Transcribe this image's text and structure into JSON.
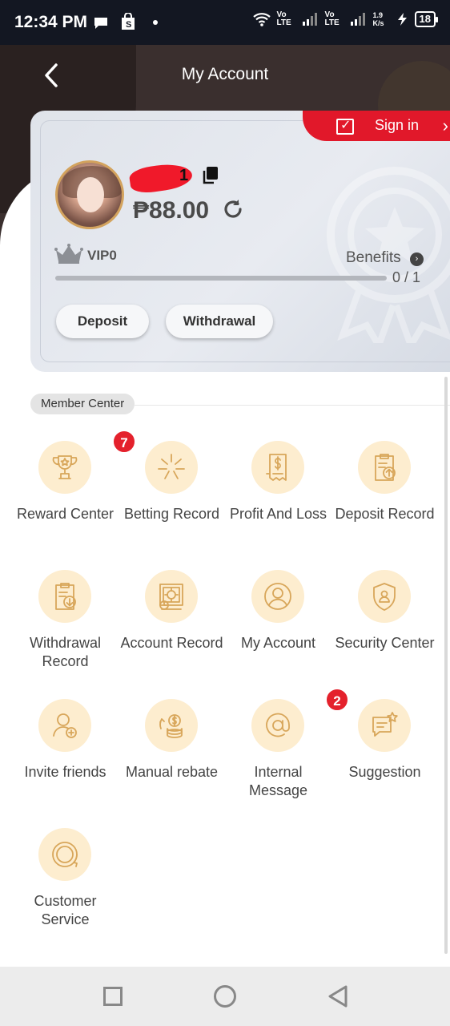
{
  "status_bar": {
    "time": "12:34 PM",
    "net1": "Vo LTE",
    "net2": "Vo LTE",
    "speed": "1.9 K/s",
    "battery": "18"
  },
  "header": {
    "title": "My Account",
    "back_icon": "chevron-left-icon"
  },
  "card": {
    "sign_in_label": "Sign in",
    "username_visible": "1",
    "balance": "₱88.00",
    "vip_label": "VIP0",
    "benefits_label": "Benefits",
    "progress_text": "0 / 1",
    "progress_value": 0,
    "deposit_label": "Deposit",
    "withdrawal_label": "Withdrawal"
  },
  "member_center": {
    "title": "Member Center",
    "items": [
      {
        "label": "Reward Center",
        "icon": "trophy-icon",
        "badge": "7"
      },
      {
        "label": "Betting Record",
        "icon": "star-burst-icon",
        "badge": ""
      },
      {
        "label": "Profit And Loss",
        "icon": "receipt-dollar-icon",
        "badge": ""
      },
      {
        "label": "Deposit Record",
        "icon": "clipboard-upload-icon",
        "badge": ""
      },
      {
        "label": "Withdrawal Record",
        "icon": "clipboard-download-icon",
        "badge": ""
      },
      {
        "label": "Account Record",
        "icon": "safe-clock-icon",
        "badge": ""
      },
      {
        "label": "My Account",
        "icon": "user-circle-icon",
        "badge": ""
      },
      {
        "label": "Security Center",
        "icon": "shield-user-icon",
        "badge": ""
      },
      {
        "label": "Invite friends",
        "icon": "user-add-icon",
        "badge": ""
      },
      {
        "label": "Manual rebate",
        "icon": "coins-rebate-icon",
        "badge": ""
      },
      {
        "label": "Internal Message",
        "icon": "at-sign-icon",
        "badge": "2"
      },
      {
        "label": "Suggestion",
        "icon": "chat-star-icon",
        "badge": ""
      },
      {
        "label": "Customer Service",
        "icon": "support-24-7-icon",
        "badge": ""
      }
    ]
  },
  "colors": {
    "header_bg": "#3a2f2e",
    "accent_red": "#e1182a",
    "icon_bg": "#fdedcf",
    "icon_stroke": "#d8a65a"
  }
}
